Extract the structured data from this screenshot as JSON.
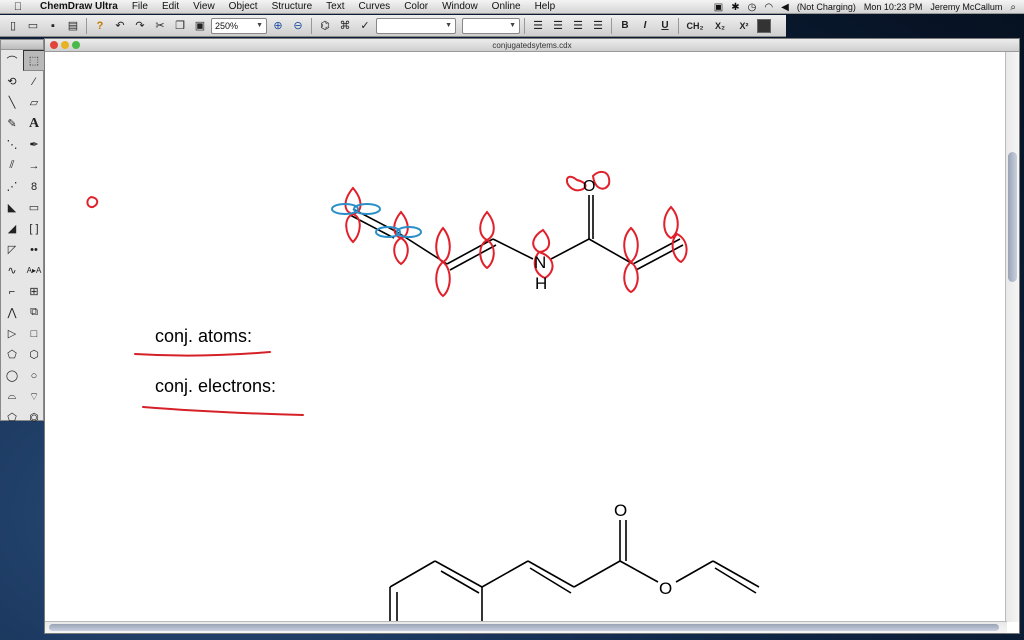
{
  "menubar": {
    "app_name": "ChemDraw Ultra",
    "items": [
      "File",
      "Edit",
      "View",
      "Object",
      "Structure",
      "Text",
      "Curves",
      "Color",
      "Window",
      "Online",
      "Help"
    ],
    "battery": "(Not Charging)",
    "clock": "Mon 10:23 PM",
    "user": "Jeremy McCallum"
  },
  "toolbar": {
    "zoom": "250%",
    "font_select": "",
    "size_select": "",
    "bold": "B",
    "italic": "I",
    "underline": "U",
    "formula": "CH₂",
    "subscript": "X₂",
    "superscript": "X²"
  },
  "document": {
    "filename": "conjugatedsytems.cdx"
  },
  "annotations": {
    "atoms_label": "conj. atoms:",
    "electrons_label": "conj. electrons:"
  },
  "molecule_top": {
    "nitrogen": "N",
    "hydrogen": "H",
    "oxygen": "O"
  },
  "molecule_bottom": {
    "carbonyl_oxygen": "O",
    "ester_oxygen": "O"
  },
  "colors": {
    "orbital_red": "#e0202a",
    "orbital_blue": "#2a8fc9",
    "underline_red": "#d62028"
  }
}
